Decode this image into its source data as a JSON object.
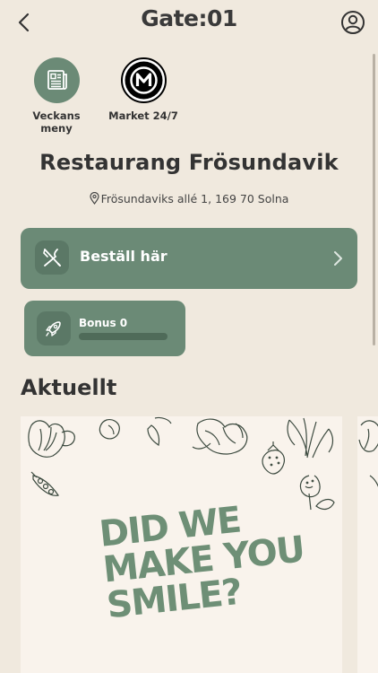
{
  "header": {
    "logo": "Gate:01"
  },
  "shortcuts": [
    {
      "label": "Veckans meny",
      "icon": "newspaper-icon"
    },
    {
      "label": "Market 24/7",
      "icon": "market-logo-icon"
    }
  ],
  "restaurant": {
    "name": "Restaurang Frösundavik",
    "address": "Frösundaviks allé 1, 169 70 Solna"
  },
  "order": {
    "label": "Beställ här",
    "icon": "cutlery-icon"
  },
  "bonus": {
    "label": "Bonus 0",
    "icon": "rocket-icon",
    "progress": 0
  },
  "news": {
    "title": "Aktuellt",
    "cards": [
      {
        "slogan": [
          "DID WE",
          "MAKE YOU",
          "SMILE?"
        ]
      }
    ]
  },
  "colors": {
    "accent": "#6b8a76",
    "background": "#f0e9de",
    "card": "#f9f3ec"
  }
}
